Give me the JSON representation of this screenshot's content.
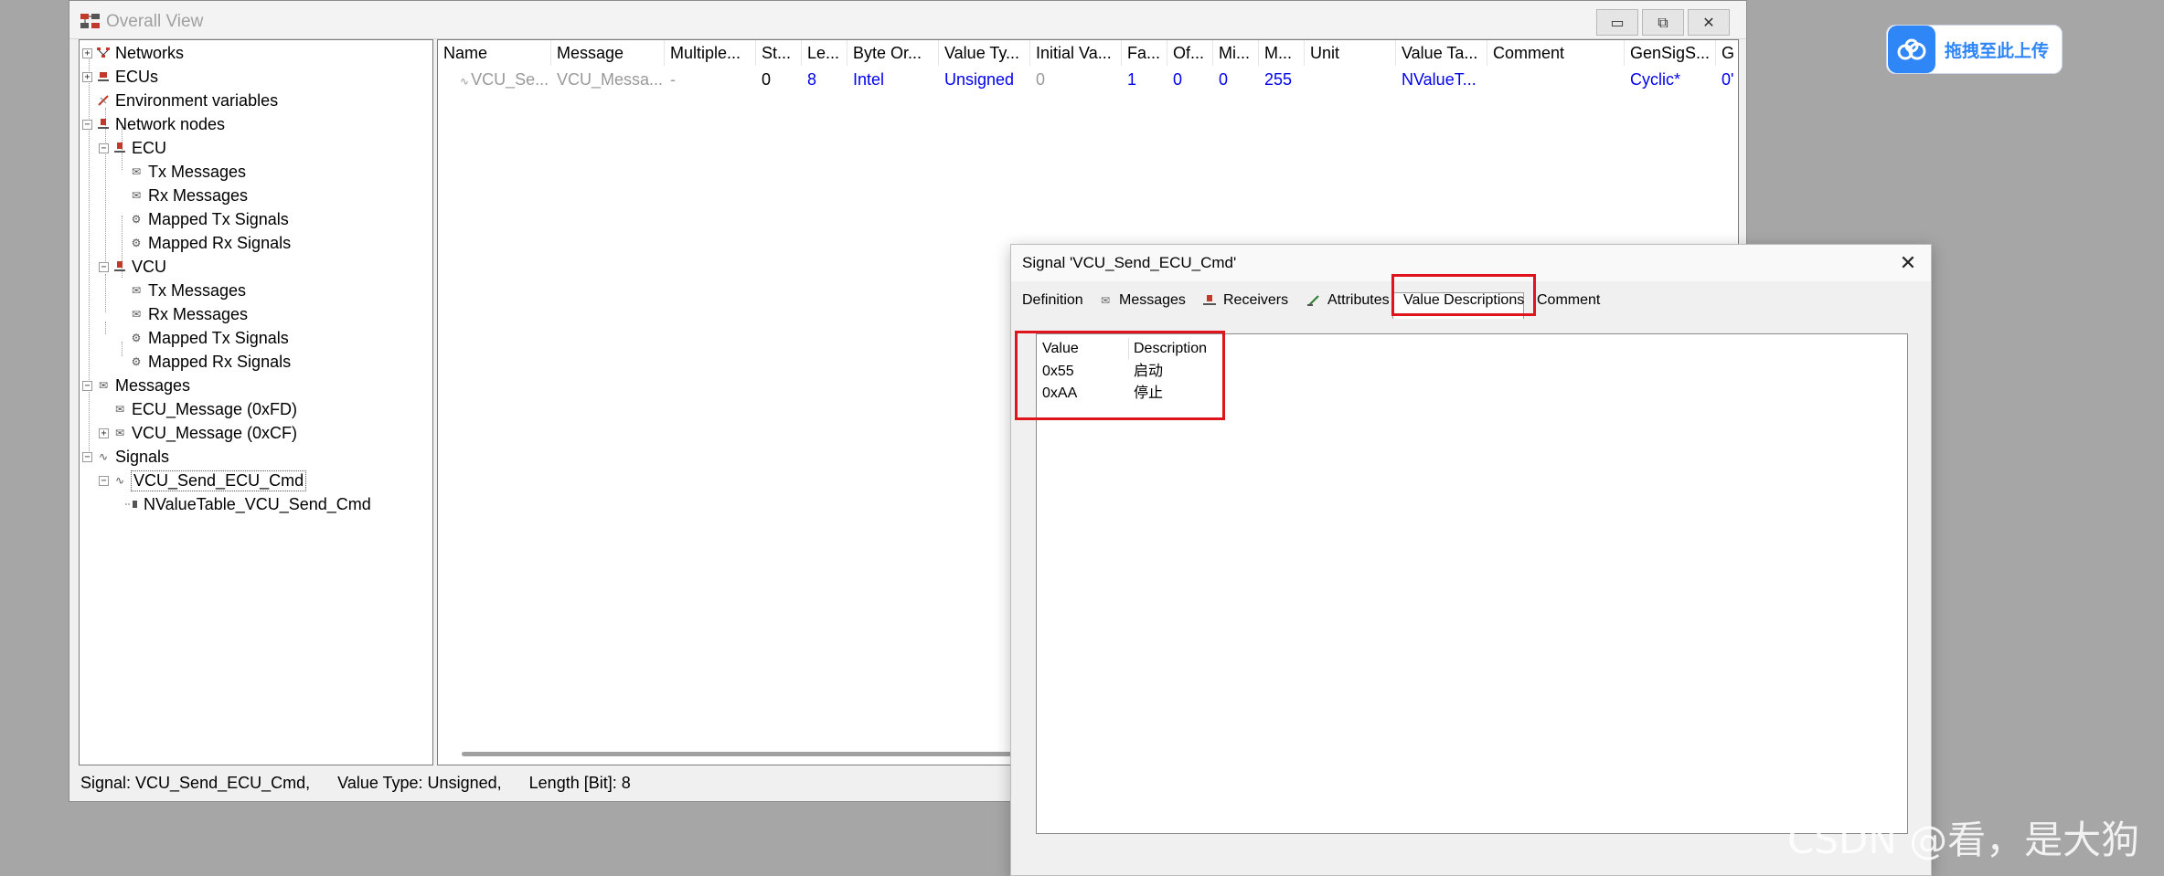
{
  "window": {
    "title": "Overall View",
    "minimize_glyph": "▭",
    "maximize_glyph": "⧉",
    "close_glyph": "✕"
  },
  "tree": {
    "items": [
      {
        "label": "Networks",
        "icon": "network-icon"
      },
      {
        "label": "ECUs",
        "icon": "ecu-icon"
      },
      {
        "label": "Environment variables",
        "icon": "env-variable-icon"
      },
      {
        "label": "Network nodes",
        "icon": "node-icon"
      },
      {
        "label": "ECU",
        "icon": "node-icon"
      },
      {
        "label": "Tx Messages",
        "icon": "message-icon"
      },
      {
        "label": "Rx Messages",
        "icon": "message-icon"
      },
      {
        "label": "Mapped Tx Signals",
        "icon": "mapped-signal-icon"
      },
      {
        "label": "Mapped Rx Signals",
        "icon": "mapped-signal-icon"
      },
      {
        "label": "VCU",
        "icon": "node-icon"
      },
      {
        "label": "Tx Messages",
        "icon": "message-icon"
      },
      {
        "label": "Rx Messages",
        "icon": "message-icon"
      },
      {
        "label": "Mapped Tx Signals",
        "icon": "mapped-signal-icon"
      },
      {
        "label": "Mapped Rx Signals",
        "icon": "mapped-signal-icon"
      },
      {
        "label": "Messages",
        "icon": "message-icon"
      },
      {
        "label": "ECU_Message (0xFD)",
        "icon": "message-icon"
      },
      {
        "label": "VCU_Message (0xCF)",
        "icon": "message-icon"
      },
      {
        "label": "Signals",
        "icon": "signal-icon"
      },
      {
        "label": "VCU_Send_ECU_Cmd",
        "icon": "signal-icon"
      },
      {
        "label": "NValueTable_VCU_Send_Cmd",
        "icon": "value-table-icon"
      }
    ]
  },
  "table": {
    "columns": [
      "Name",
      "Message",
      "Multiple...",
      "St...",
      "Le...",
      "Byte Or...",
      "Value Ty...",
      "Initial Va...",
      "Fa...",
      "Of...",
      "Mi...",
      "M...",
      "Unit",
      "Value Ta...",
      "Comment",
      "GenSigS...",
      "G"
    ],
    "row": [
      "VCU_Se...",
      "VCU_Messa...",
      "-",
      "0",
      "8",
      "Intel",
      "Unsigned",
      "0",
      "1",
      "0",
      "0",
      "255",
      "",
      "NValueT...",
      "",
      "Cyclic*",
      "0'"
    ]
  },
  "status": {
    "signal": "Signal: VCU_Send_ECU_Cmd,",
    "value_type": "Value Type: Unsigned,",
    "length": "Length [Bit]: 8"
  },
  "dialog": {
    "title": "Signal 'VCU_Send_ECU_Cmd'",
    "close_glyph": "✕",
    "tabs": [
      "Definition",
      "Messages",
      "Receivers",
      "Attributes",
      "Value Descriptions",
      "Comment"
    ],
    "value_list": {
      "headers": [
        "Value",
        "Description"
      ],
      "rows": [
        {
          "value": "0x55",
          "description": "启动"
        },
        {
          "value": "0xAA",
          "description": "停止"
        }
      ]
    }
  },
  "upload": {
    "label": "拖拽至此上传",
    "icon": "cloud-upload-icon"
  },
  "watermark": "CSDN @看，是大狗",
  "colors": {
    "blue_value": "#0000ee",
    "gray_value": "#999999",
    "highlight_red": "#e0141c",
    "upload_blue": "#2f86f6"
  }
}
